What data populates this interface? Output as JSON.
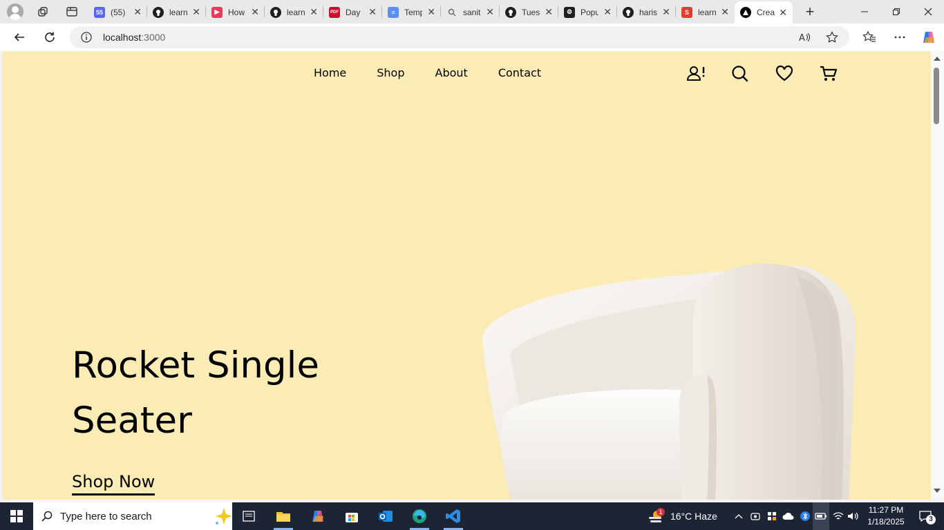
{
  "browser": {
    "tabs": [
      {
        "title": "(55)",
        "favicon": "discord-favicon",
        "color": "#5865f2",
        "glyph": "55"
      },
      {
        "title": "learn",
        "favicon": "github-favicon",
        "color": "#1f1f1f",
        "glyph": ""
      },
      {
        "title": "How",
        "favicon": "youtube-favicon",
        "color": "#e63b5a",
        "glyph": "▶"
      },
      {
        "title": "learn",
        "favicon": "github-favicon",
        "color": "#1f1f1f",
        "glyph": ""
      },
      {
        "title": "Day",
        "favicon": "pdf-favicon",
        "color": "#c8102e",
        "glyph": "PDF"
      },
      {
        "title": "Temp",
        "favicon": "docs-favicon",
        "color": "#5b8ef5",
        "glyph": "≡"
      },
      {
        "title": "sanit",
        "favicon": "search-favicon",
        "color": "#e9e9e9",
        "glyph": "🔍"
      },
      {
        "title": "Tues",
        "favicon": "github-favicon",
        "color": "#1f1f1f",
        "glyph": ""
      },
      {
        "title": "Popu",
        "favicon": "chatgpt-favicon",
        "color": "#1f1f1f",
        "glyph": "⚙"
      },
      {
        "title": "haris",
        "favicon": "github-favicon",
        "color": "#1f1f1f",
        "glyph": ""
      },
      {
        "title": "learn",
        "favicon": "s-favicon",
        "color": "#e63b2e",
        "glyph": "S"
      },
      {
        "title": "Crea",
        "favicon": "vercel-favicon",
        "color": "#000000",
        "glyph": "▲",
        "active": true
      }
    ],
    "new_tab_glyph": "+",
    "url_host": "localhost",
    "url_rest": ":3000"
  },
  "site": {
    "nav": [
      "Home",
      "Shop",
      "About",
      "Contact"
    ],
    "hero_title": "Rocket Single Seater",
    "cta": "Shop Now",
    "bg": "#fbebb5"
  },
  "taskbar": {
    "search_placeholder": "Type here to search",
    "weather": "16°C  Haze",
    "weather_badge": "1",
    "time": "11:27 PM",
    "date": "1/18/2025",
    "notifications": "3"
  }
}
